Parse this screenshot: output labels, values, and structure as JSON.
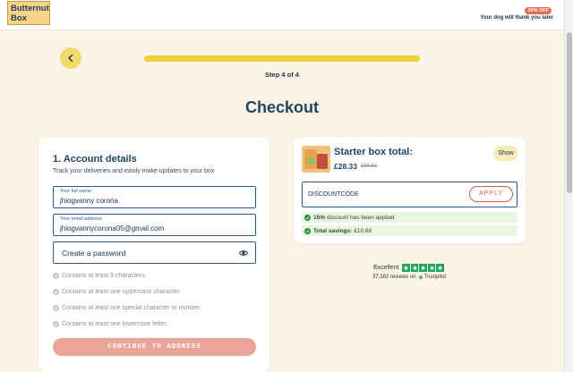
{
  "header": {
    "logo_text": "Butternut Box",
    "promo_badge": "15% OFF",
    "promo_text": "Your dog will thank you later"
  },
  "progress": {
    "step_label": "Step 4 of 4",
    "fraction": 1.0
  },
  "page": {
    "title": "Checkout"
  },
  "account": {
    "section_title": "1. Account details",
    "subtitle": "Track your deliveries and easily make updates to your box",
    "name_label": "Your full name",
    "name_value": "jhiogvanny corona",
    "email_label": "Your email address",
    "email_value": "jhiogvannycorona05@gmail.com",
    "password_placeholder": "Create a password",
    "rules": [
      "Contains at least 8 characters.",
      "Contains at least one uppercase character.",
      "Contains at least one special character or number.",
      "Contains at least one lowercase letter."
    ],
    "continue_label": "CONTINUE TO ADDRESS"
  },
  "summary": {
    "title": "Starter box total:",
    "price": "£28.33",
    "old_price": "£99.61",
    "show_label": "Show",
    "discount_code": "DISCOUNTCODE",
    "apply_label": "APPLY",
    "notice1_bold": "15%",
    "notice1_rest": "discount has been applied",
    "notice2_bold": "Total savings:",
    "notice2_rest": "£10.68"
  },
  "trustpilot": {
    "rating_word": "Excellent",
    "reviews": "37,182 reviews on",
    "brand": "Trustpilot",
    "stars": 5
  },
  "colors": {
    "accent_yellow": "#f5cf3b",
    "cta": "#eba597",
    "heading": "#1f4460",
    "success": "#2f8f3a"
  }
}
